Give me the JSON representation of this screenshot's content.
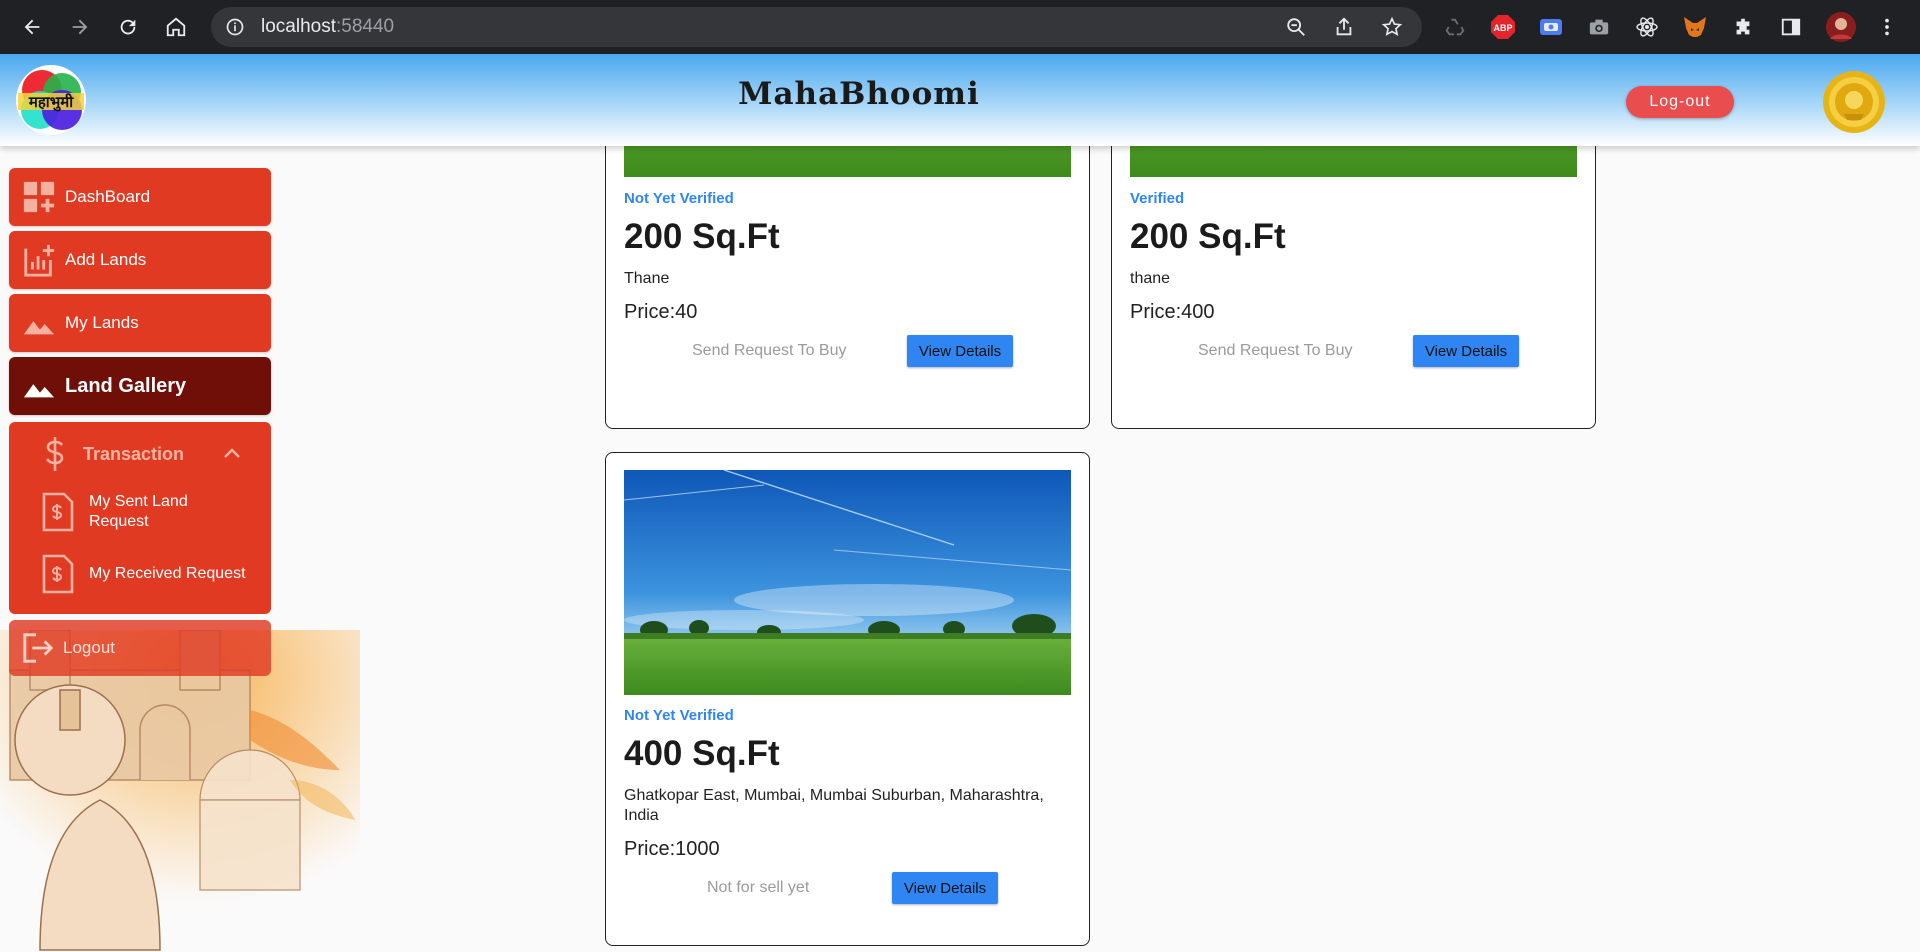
{
  "browser": {
    "url_host": "localhost",
    "url_port": ":58440"
  },
  "header": {
    "title": "MahaBhoomi",
    "logo_text": "महाभुमी",
    "logout_label": "Log-out"
  },
  "sidebar": {
    "items": [
      {
        "label": "DashBoard",
        "icon": "dashboard-icon"
      },
      {
        "label": "Add Lands",
        "icon": "add-chart-icon"
      },
      {
        "label": "My Lands",
        "icon": "landscape-icon"
      },
      {
        "label": "Land Gallery",
        "icon": "landscape-icon",
        "active": true
      }
    ],
    "transaction": {
      "label": "Transaction",
      "subitems": [
        {
          "label": "My Sent Land Request"
        },
        {
          "label": "My Received Request"
        }
      ]
    },
    "logout_label": "Logout"
  },
  "cards": [
    {
      "status": "Not Yet Verified",
      "area": "200 Sq.Ft",
      "location": "Thane",
      "price": "Price:40",
      "action": "Send Request To Buy",
      "view": "View Details"
    },
    {
      "status": "Verified",
      "area": "200 Sq.Ft",
      "location": "thane",
      "price": "Price:400",
      "action": "Send Request To Buy",
      "view": "View Details"
    },
    {
      "status": "Not Yet Verified",
      "area": "400 Sq.Ft",
      "location": "Ghatkopar East, Mumbai, Mumbai Suburban, Maharashtra, India",
      "price": "Price:1000",
      "action": "Not for sell yet",
      "view": "View Details"
    }
  ],
  "colors": {
    "sidebar": "#e03a23",
    "sidebar_active": "#6f0f07",
    "accent_blue": "#2f86f2",
    "logout_pill": "#e94d4d"
  }
}
